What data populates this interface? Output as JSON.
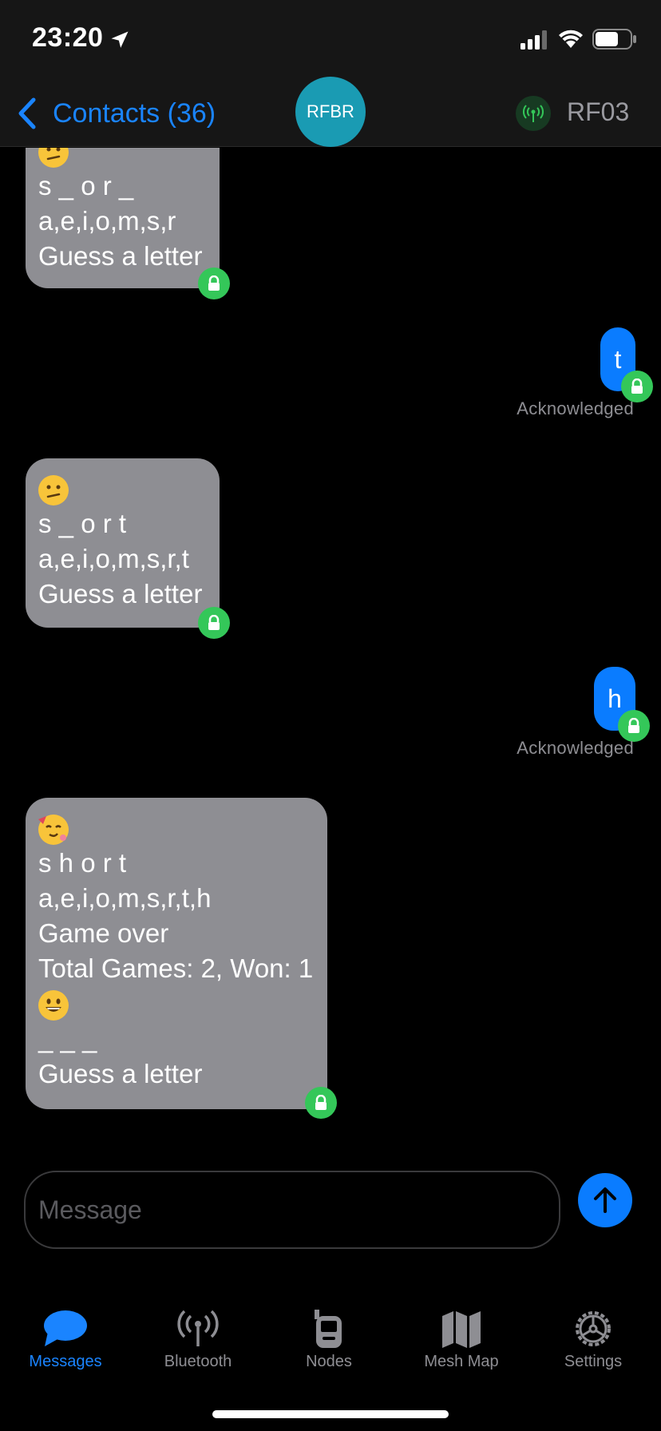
{
  "status_bar": {
    "time": "23:20"
  },
  "nav": {
    "back_label": "Contacts (36)",
    "avatar_text": "RFBR",
    "node_name": "RF03"
  },
  "messages": [
    {
      "direction": "in",
      "lines": [
        "s _ o r _",
        "a,e,i,o,m,s,r",
        "Guess a letter"
      ],
      "emoji": "confused"
    },
    {
      "direction": "out",
      "text": "t",
      "status": "Acknowledged"
    },
    {
      "direction": "in",
      "emoji": "confused",
      "lines": [
        "s _ o r t",
        "a,e,i,o,m,s,r,t",
        "Guess a letter"
      ]
    },
    {
      "direction": "out",
      "text": "h",
      "status": "Acknowledged"
    },
    {
      "direction": "in",
      "emoji": "party",
      "lines": [
        "s h o r t",
        "a,e,i,o,m,s,r,t,h",
        "Game over",
        "Total Games: 2, Won: 1"
      ],
      "emoji2": "grinning",
      "lines2": [
        "_ _ _",
        "Guess a letter"
      ]
    }
  ],
  "composer": {
    "placeholder": "Message"
  },
  "tabs": [
    {
      "label": "Messages",
      "icon": "chat-bubble-icon",
      "active": true
    },
    {
      "label": "Bluetooth",
      "icon": "antenna-icon",
      "active": false
    },
    {
      "label": "Nodes",
      "icon": "radio-device-icon",
      "active": false
    },
    {
      "label": "Mesh Map",
      "icon": "map-icon",
      "active": false
    },
    {
      "label": "Settings",
      "icon": "gear-icon",
      "active": false
    }
  ],
  "colors": {
    "accent": "#1a84ff",
    "incoming_bubble": "#8e8e93",
    "outgoing_bubble": "#0a7cff",
    "lock_badge": "#34c759",
    "avatar": "#1a9bb3"
  }
}
